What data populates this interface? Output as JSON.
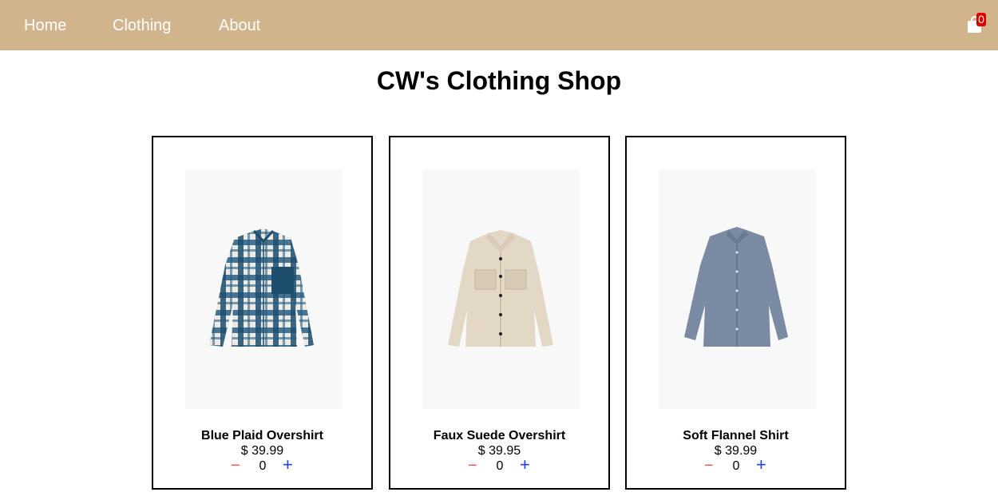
{
  "nav": {
    "links": [
      "Home",
      "Clothing",
      "About"
    ],
    "cart_count": "0"
  },
  "page_title": "CW's Clothing Shop",
  "products": [
    {
      "name": "Blue Plaid Overshirt",
      "price": "$ 39.99",
      "quantity": "0",
      "minus": "−",
      "plus": "+"
    },
    {
      "name": "Faux Suede Overshirt",
      "price": "$ 39.95",
      "quantity": "0",
      "minus": "−",
      "plus": "+"
    },
    {
      "name": "Soft Flannel Shirt",
      "price": "$ 39.99",
      "quantity": "0",
      "minus": "−",
      "plus": "+"
    }
  ],
  "colors": {
    "nav_bg": "#d2b48c",
    "badge": "#e00000",
    "minus": "#ff4d4d",
    "plus": "#1f3fff"
  }
}
